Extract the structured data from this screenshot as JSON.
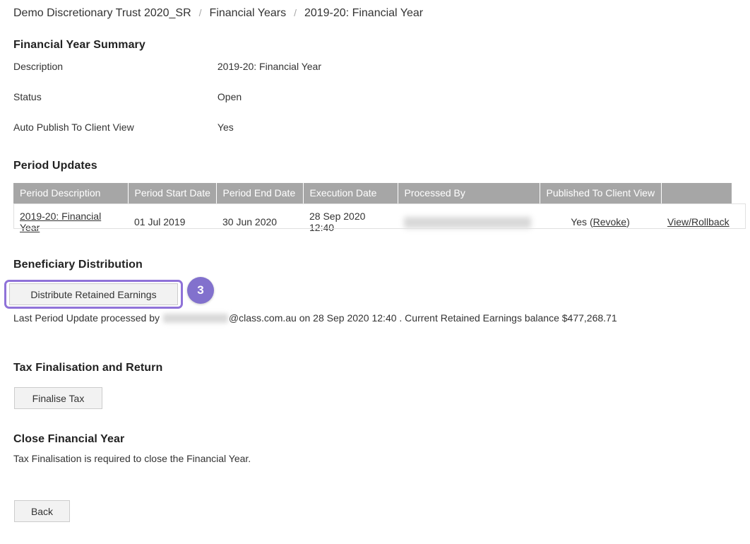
{
  "breadcrumb": {
    "separator": "/",
    "items": [
      {
        "label": "Demo Discretionary Trust 2020_SR"
      },
      {
        "label": "Financial Years"
      },
      {
        "label": "2019-20: Financial Year"
      }
    ]
  },
  "summary": {
    "heading": "Financial Year Summary",
    "rows": [
      {
        "label": "Description",
        "value": "2019-20: Financial Year"
      },
      {
        "label": "Status",
        "value": "Open"
      },
      {
        "label": "Auto Publish To Client View",
        "value": "Yes"
      }
    ]
  },
  "period_updates": {
    "heading": "Period Updates",
    "columns": [
      "Period Description",
      "Period Start Date",
      "Period End Date",
      "Execution Date",
      "Processed By",
      "Published To Client View",
      ""
    ],
    "rows": [
      {
        "period_description": "2019-20: Financial Year",
        "period_start_date": "01 Jul 2019",
        "period_end_date": "30 Jun 2020",
        "execution_date": "28 Sep 2020 12:40",
        "processed_by": "",
        "published_to_client_view": "Yes",
        "revoke_label": "Revoke",
        "action_label": "View/Rollback"
      }
    ]
  },
  "beneficiary_distribution": {
    "heading": "Beneficiary Distribution",
    "distribute_button_label": "Distribute Retained Earnings",
    "step_badge": "3",
    "note_prefix": "Last Period Update processed by",
    "note_email_suffix": "@class.com.au",
    "note_middle": "on 28 Sep 2020 12:40 . Current Retained Earnings balance",
    "note_balance": "$477,268.71"
  },
  "tax_finalisation": {
    "heading": "Tax Finalisation and Return",
    "finalise_button_label": "Finalise Tax"
  },
  "close_financial_year": {
    "heading": "Close Financial Year",
    "description": "Tax Finalisation is required to close the Financial Year."
  },
  "footer": {
    "back_button_label": "Back"
  },
  "colors": {
    "accent_purple": "#8271cd",
    "highlight_purple": "#8f72d8",
    "table_header_grey": "#a6a6a6",
    "button_face": "#f2f2f2"
  }
}
